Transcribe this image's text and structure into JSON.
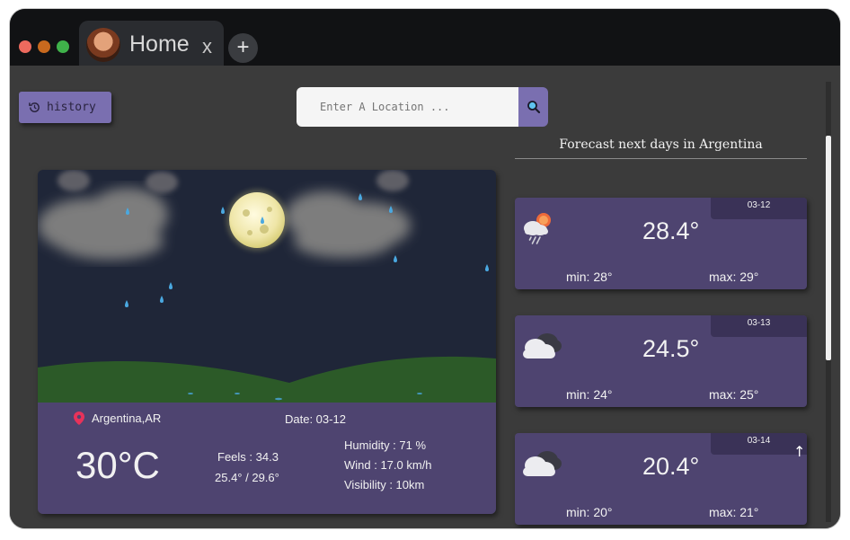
{
  "browser": {
    "tab_title": "Home",
    "tab_close": "x",
    "new_tab": "+"
  },
  "history_button": {
    "label": "history"
  },
  "search": {
    "placeholder": "Enter A Location ..."
  },
  "forecast": {
    "title": "Forecast next days in Argentina",
    "days": [
      {
        "date": "03-12",
        "temp": "28.4°",
        "min": "min: 28°",
        "max": "max: 29°",
        "icon": "rain-sun-cloud-icon"
      },
      {
        "date": "03-13",
        "temp": "24.5°",
        "min": "min: 24°",
        "max": "max: 25°",
        "icon": "cloud-icon"
      },
      {
        "date": "03-14",
        "temp": "20.4°",
        "min": "min: 20°",
        "max": "max: 21°",
        "icon": "cloud-icon"
      }
    ]
  },
  "current": {
    "location": "Argentina,AR",
    "date": "Date: 03-12",
    "temp": "30°C",
    "feels": "Feels :  34.3",
    "minmax": "25.4° / 29.6°",
    "humidity": "Humidity :  71 %",
    "wind": "Wind :  17.0 km/h",
    "visibility": "Visibility :  10km"
  },
  "scroll_top": "↑",
  "colors": {
    "accent": "#7a6fb0",
    "card": "#4e4470",
    "card_date": "#3a3257",
    "background": "#3b3b3b",
    "pin": "#e8325a"
  }
}
